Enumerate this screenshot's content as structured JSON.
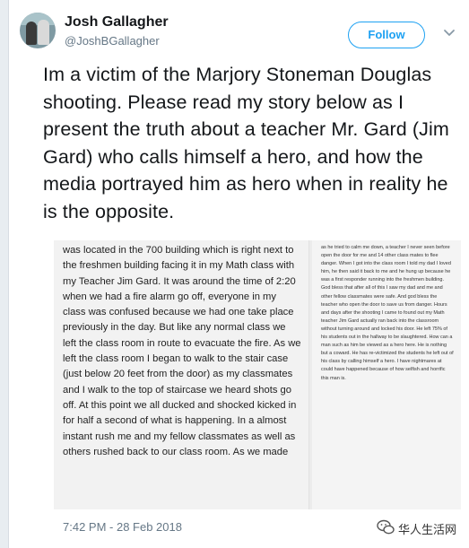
{
  "user": {
    "name": "Josh Gallagher",
    "handle": "@JoshBGallagher"
  },
  "actions": {
    "follow_label": "Follow"
  },
  "tweet": {
    "text": "Im a victim of the Marjory Stoneman Douglas shooting. Please read my story below as I present the truth about a teacher Mr. Gard (Jim Gard) who calls himself a hero, and how the media portrayed him as hero when in reality he is the opposite.",
    "timestamp": "7:42 PM - 28 Feb 2018"
  },
  "image": {
    "col1_text": "was located in the 700 building which is right next to the freshmen building facing it in my Math class with my Teacher Jim Gard. It was around the time of 2:20 when we had a fire alarm go off, everyone in my class was confused because we had one take place previously in the day. But like any normal class we left the class room in route to evacuate the fire. As we left the class room I began to walk to the stair case (just below 20 feet from the door) as my classmates and I walk to the top of staircase we heard shots go off. At this point we all ducked and shocked kicked in for half a second of what is happening. In a almost instant rush me and my fellow classmates as well as others rushed back to our class room. As we made",
    "col2_text": "as he tried to calm me down, a teacher I never seen before open the door for me and 14 other class mates to flee danger. When I got into the class room I told my dad I loved him, he then said it back to me and he hung up because he was a first responder running into the freshmen building. God bless that after all of this I saw my dad and me and other fellow classmates were safe. And god bless the teacher who open the door to save us from danger. Hours and days after the shooting I came to found out my Math teacher Jim Gard actually ran back into the classroom without turning around and locked his door. He left 75% of his students out in the hallway to be slaughtered. How can a man such as him be viewed as a hero here. He is nothing but a coward. He has re-victimized  the students he left out of his class by calling himself a hero. I have nightmares at could have happened because of how selfish and horrific this man is."
  },
  "watermark": {
    "text": "华人生活网"
  }
}
